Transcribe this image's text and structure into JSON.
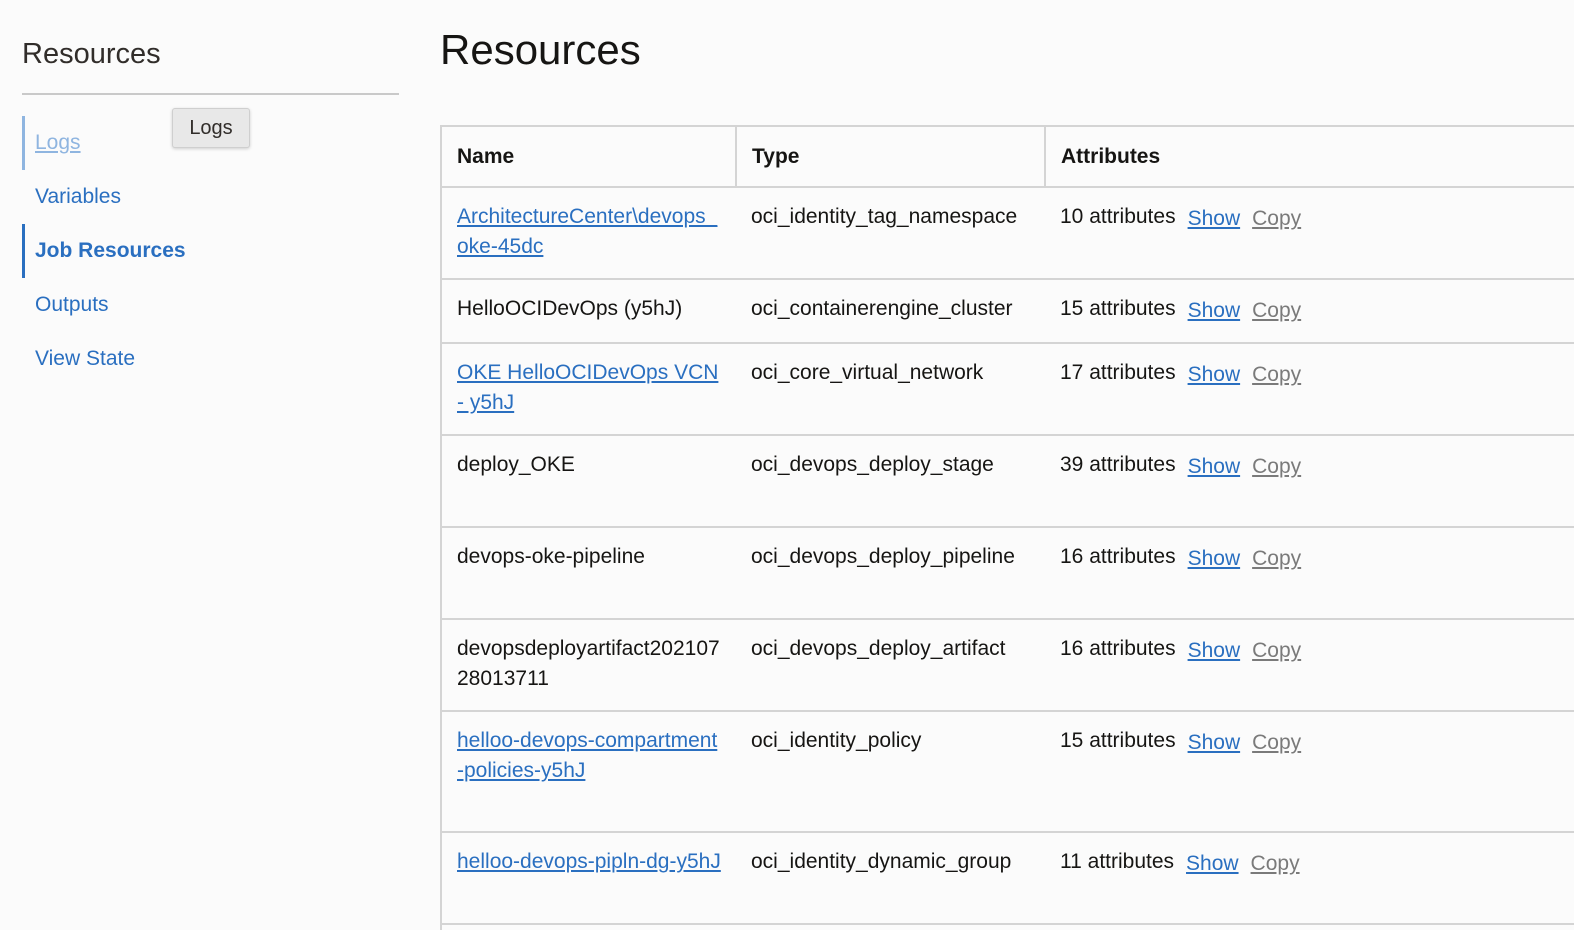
{
  "sidebar": {
    "title": "Resources",
    "items": [
      {
        "label": "Logs"
      },
      {
        "label": "Variables"
      },
      {
        "label": "Job Resources"
      },
      {
        "label": "Outputs"
      },
      {
        "label": "View State"
      }
    ],
    "tooltip": "Logs"
  },
  "main": {
    "title": "Resources",
    "table": {
      "headers": {
        "name": "Name",
        "type": "Type",
        "attributes": "Attributes"
      },
      "show_label": "Show",
      "copy_label": "Copy",
      "rows": [
        {
          "name": "ArchitectureCenter\\devops_oke-45dc",
          "name_is_link": true,
          "type": "oci_identity_tag_namespace",
          "attributes": "10 attributes"
        },
        {
          "name": "HelloOCIDevOps (y5hJ)",
          "name_is_link": false,
          "type": "oci_containerengine_cluster",
          "attributes": "15 attributes"
        },
        {
          "name": "OKE HelloOCIDevOps VCN - y5hJ",
          "name_is_link": true,
          "type": "oci_core_virtual_network",
          "attributes": "17 attributes"
        },
        {
          "name": "deploy_OKE",
          "name_is_link": false,
          "type": "oci_devops_deploy_stage",
          "attributes": "39 attributes"
        },
        {
          "name": "devops-oke-pipeline",
          "name_is_link": false,
          "type": "oci_devops_deploy_pipeline",
          "attributes": "16 attributes"
        },
        {
          "name": "devopsdeployartifact20210728013711",
          "name_is_link": false,
          "type": "oci_devops_deploy_artifact",
          "attributes": "16 attributes"
        },
        {
          "name": "helloo-devops-compartment-policies-y5hJ",
          "name_is_link": true,
          "type": "oci_identity_policy",
          "attributes": "15 attributes"
        },
        {
          "name": "helloo-devops-pipln-dg-y5hJ",
          "name_is_link": true,
          "type": "oci_identity_dynamic_group",
          "attributes": "11 attributes"
        }
      ]
    }
  },
  "colors": {
    "link": "#2a6fc0",
    "link_muted": "#8fb5e0",
    "copy": "#7a7a7a",
    "border": "#d4d4d4",
    "background": "#fbfbfb"
  }
}
